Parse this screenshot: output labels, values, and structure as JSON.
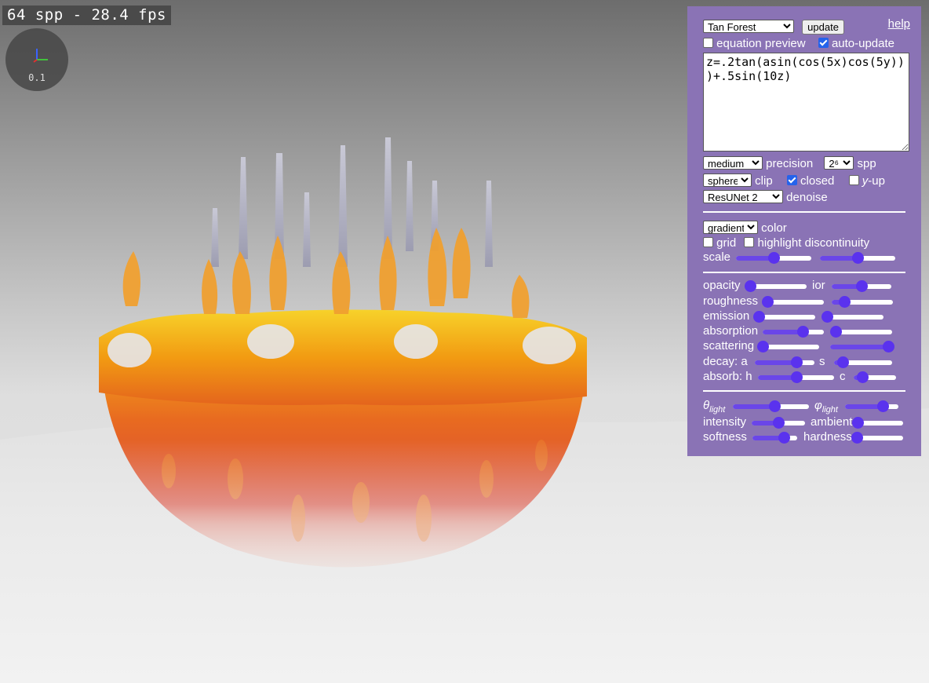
{
  "viewport": {
    "fps_text": "64 spp - 28.4 fps",
    "axes_scale": "0.1"
  },
  "panel": {
    "preset": "Tan Forest",
    "update_label": "update",
    "help_label": "help",
    "equation_preview_label": "equation preview",
    "equation_preview_checked": false,
    "auto_update_label": "auto-update",
    "auto_update_checked": true,
    "equation": "z=.2tan(asin(cos(5x)cos(5y)))+.5sin(10z)",
    "precision_value": "medium",
    "precision_label": "precision",
    "spp_value": "2⁶",
    "spp_label": "spp",
    "clip_value": "sphere",
    "clip_label": "clip",
    "closed_label": "closed",
    "closed_checked": true,
    "y_label": "y",
    "yup_suffix": "-up",
    "yup_checked": false,
    "denoise_value": "ResUNet 2",
    "denoise_label": "denoise",
    "color_value": "gradient",
    "color_label": "color",
    "grid_label": "grid",
    "grid_checked": false,
    "discontinuity_label": "highlight discontinuity",
    "discontinuity_checked": false,
    "scale_label": "scale",
    "opacity_label": "opacity",
    "ior_label": "ior",
    "roughness_label": "roughness",
    "emission_label": "emission",
    "absorption_label": "absorption",
    "scattering_label": "scattering",
    "decay_label": "decay: a",
    "decay_s_label": "s",
    "absorb_label": "absorb: h",
    "absorb_c_label": "c",
    "theta_symbol": "θ",
    "phi_symbol": "φ",
    "light_sub": "light",
    "intensity_label": "intensity",
    "ambient_label": "ambient",
    "softness_label": "softness",
    "hardness_label": "hardness"
  },
  "sliders": {
    "scale_1": 0.5,
    "scale_2": 0.5,
    "opacity": 0.0,
    "ior": 0.5,
    "roughness": 0.0,
    "roughness_2": 0.2,
    "emission": 0.0,
    "emission_2": 0.0,
    "absorption": 0.65,
    "absorption_2": 0.0,
    "scattering": 0.0,
    "scattering_2": 1.0,
    "decay_a": 0.7,
    "decay_s": 0.15,
    "absorb_h": 0.5,
    "absorb_c": 0.2,
    "theta_light": 0.55,
    "phi_light": 0.7,
    "intensity": 0.5,
    "ambient": 0.0,
    "softness": 0.7,
    "hardness": 0.0
  }
}
